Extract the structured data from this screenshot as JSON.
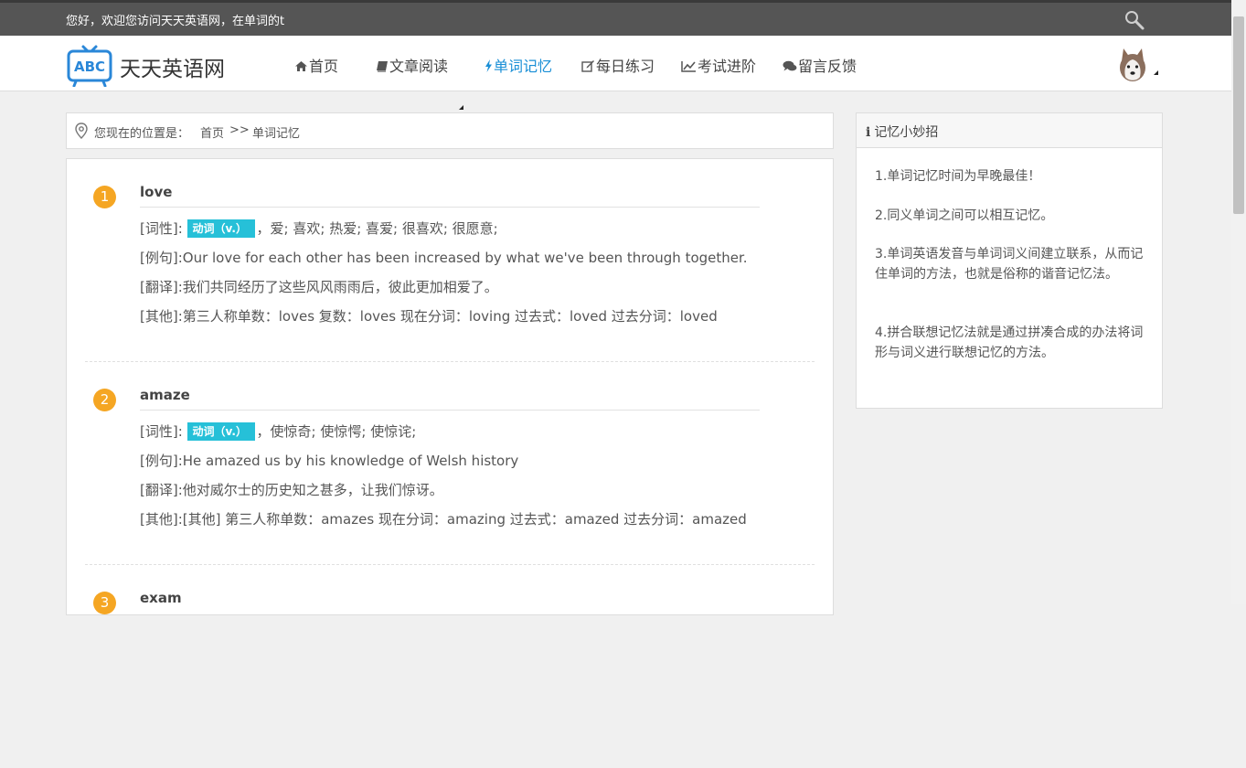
{
  "topbar": {
    "text": "您好，欢迎您访问天天英语网，在单词的t"
  },
  "header": {
    "logo_badge": "ABC",
    "logo_text": "天天英语网",
    "nav": [
      {
        "label": "首页",
        "icon": "home-icon"
      },
      {
        "label": "文章阅读",
        "icon": "book-icon"
      },
      {
        "label": "单词记忆",
        "icon": "bolt-icon",
        "active": true
      },
      {
        "label": "每日练习",
        "icon": "edit-icon"
      },
      {
        "label": "考试进阶",
        "icon": "line-chart-icon"
      },
      {
        "label": "留言反馈",
        "icon": "comments-icon"
      }
    ]
  },
  "breadcrumb": {
    "label": "您现在的位置是：",
    "home": "首页",
    "sep": ">>",
    "current": "单词记忆"
  },
  "words": [
    {
      "num": "1",
      "word": "love",
      "pos_label": "[词性]:",
      "pos": "动词（v.）",
      "meaning": "，爱; 喜欢; 热爱; 喜爱; 很喜欢; 很愿意;",
      "example_label": "[例句]:",
      "example": "Our love for each other has been increased by what we've been through together.",
      "translation_label": "[翻译]:",
      "translation": "我们共同经历了这些风风雨雨后，彼此更加相爱了。",
      "other_label": "[其他]:",
      "other": "第三人称单数：loves 复数：loves 现在分词：loving 过去式：loved 过去分词：loved"
    },
    {
      "num": "2",
      "word": "amaze",
      "pos_label": "[词性]:",
      "pos": "动词（v.）",
      "meaning": "，使惊奇; 使惊愕; 使惊诧;",
      "example_label": "[例句]:",
      "example": "He amazed us by his knowledge of Welsh history",
      "translation_label": "[翻译]:",
      "translation": "他对威尔士的历史知之甚多，让我们惊讶。",
      "other_label": "[其他]:",
      "other": "[其他] 第三人称单数：amazes 现在分词：amazing 过去式：amazed 过去分词：amazed"
    },
    {
      "num": "3",
      "word": "exam"
    }
  ],
  "tips": {
    "icon": "i",
    "title": "记忆小妙招",
    "items": [
      "1.单词记忆时间为早晚最佳！",
      "2.同义单词之间可以相互记忆。",
      "3.单词英语发音与单词词义间建立联系，从而记住单词的方法，也就是俗称的谐音记忆法。",
      "4.拼合联想记忆法就是通过拼凑合成的办法将词形与词义进行联想记忆的方法。"
    ]
  },
  "colors": {
    "accent": "#1a8fd6",
    "badge": "#26c0d8",
    "number": "#f5a623",
    "topbar": "#555555"
  }
}
